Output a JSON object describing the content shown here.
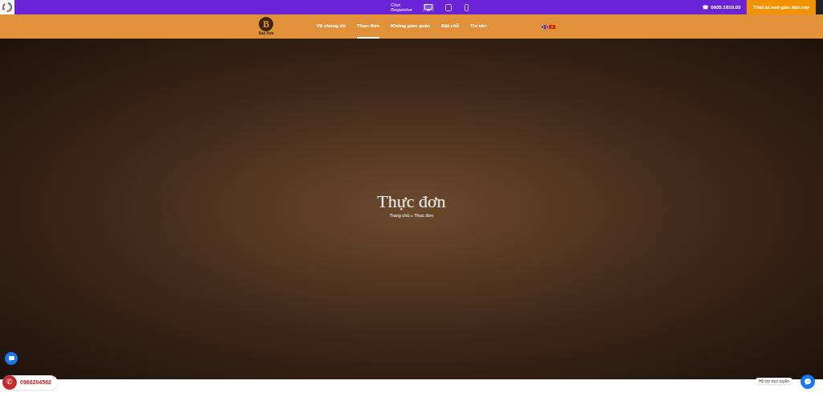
{
  "topbar": {
    "responsive_label": "Chọn Responsive",
    "devices": [
      {
        "kind": "desktop",
        "selected": true
      },
      {
        "kind": "tablet",
        "selected": false
      },
      {
        "kind": "mobile",
        "selected": false
      }
    ],
    "phone": "0935.1010.03",
    "cta": "Thiết kế web giao diện này"
  },
  "header": {
    "logo_letter": "B",
    "logo": "Bếp Xưa",
    "nav": [
      {
        "label": "Về chúng tôi",
        "selected": false
      },
      {
        "label": "Thực đơn",
        "selected": true
      },
      {
        "label": "Không gian quán",
        "selected": false
      },
      {
        "label": "Đặt chỗ",
        "selected": false
      },
      {
        "label": "Tin tức",
        "selected": false
      }
    ],
    "languages": [
      {
        "kind": "en"
      },
      {
        "kind": "vi"
      }
    ]
  },
  "hero": {
    "title": "Thực đơn",
    "breadcrumb": "Trang chủ » Thực đơn"
  },
  "floating": {
    "phone": "0966204562",
    "support": "Hỗ trợ trực tuyến"
  }
}
